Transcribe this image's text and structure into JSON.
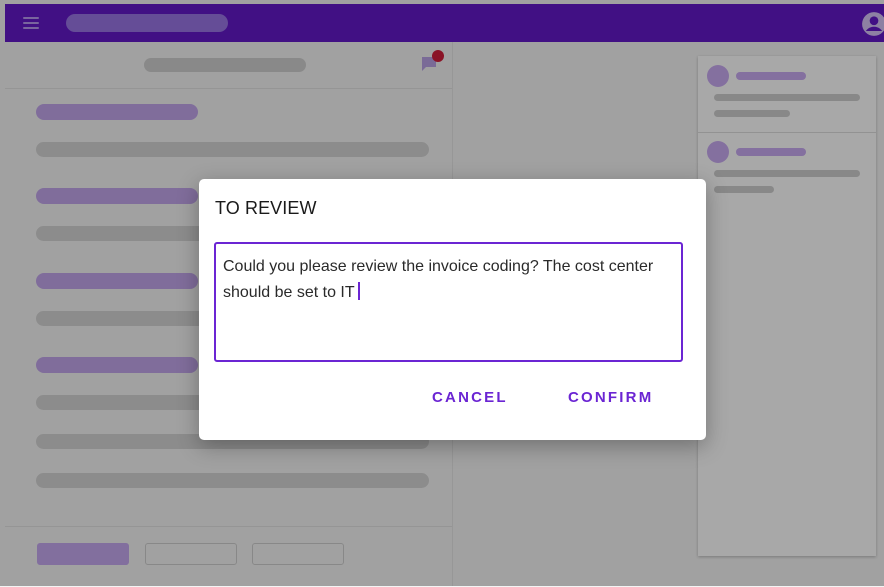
{
  "icons": {
    "menu": "hamburger-menu-icon",
    "account": "account-circle-icon",
    "comments": "chat-bubble-icon"
  },
  "colors": {
    "app_bar": "#6319c9",
    "accent": "#6b25d3",
    "notification_dot": "#d21d3a"
  },
  "dialog": {
    "title": "TO REVIEW",
    "text": "Could you please review the invoice coding? The cost center should be set to IT",
    "cancel_label": "CANCEL",
    "confirm_label": "CONFIRM"
  }
}
